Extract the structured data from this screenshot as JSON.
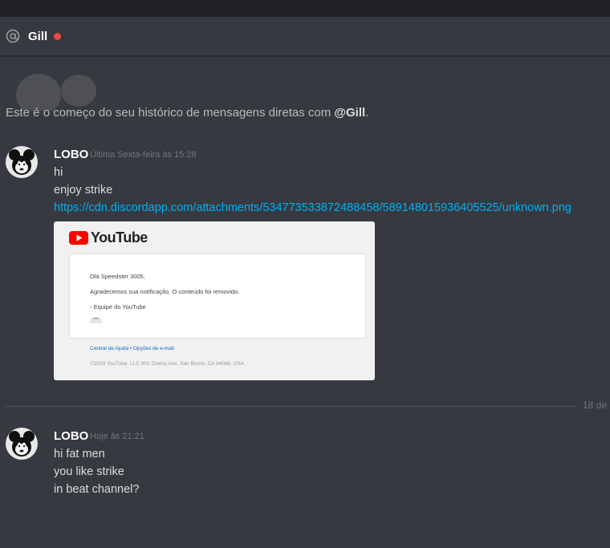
{
  "header": {
    "channel_icon": "at-icon",
    "user_name": "Gill",
    "status": "dnd",
    "status_color": "#f04747"
  },
  "intro": {
    "prefix": "Este é o começo do seu histórico de mensagens diretas com ",
    "mention": "@Gill",
    "suffix": "."
  },
  "messages": [
    {
      "author": "LOBO",
      "timestamp": "Última Sexta-feira às 15:28",
      "lines": [
        "hi",
        "enjoy strike"
      ],
      "link": "https://cdn.discordapp.com/attachments/534773533872488458/589148015936405525/unknown.png",
      "embed": {
        "logo_text": "YouTube",
        "greeting": "Olá Speedster 3005,",
        "body": "Agradecemos sua notificação. O conteúdo foi removido.",
        "signature": "- Equipe do YouTube",
        "dots": "•••",
        "footer_links": "Central de Ajuda • Opções de e-mail",
        "footer_address": "©2019 YouTube, LLC 901 Cherry Ave, San Bruno, CA 94066, USA"
      }
    },
    {
      "author": "LOBO",
      "timestamp": "Hoje às 21:21",
      "lines": [
        "hi fat men",
        "you like strike",
        "in beat channel?"
      ]
    }
  ],
  "date_divider": "18 de"
}
